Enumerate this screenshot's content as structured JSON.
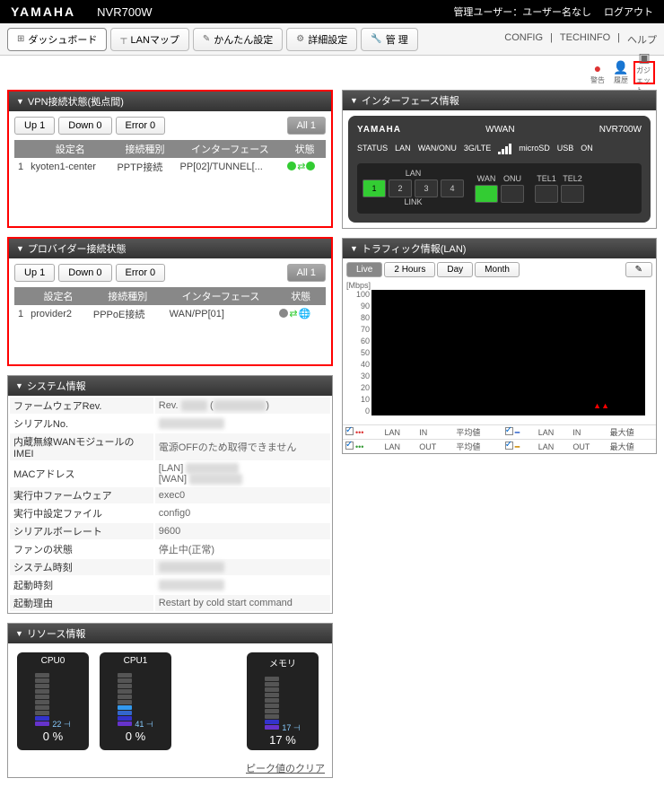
{
  "header": {
    "logo": "YAMAHA",
    "product": "NVR700W",
    "admin_user_label": "管理ユーザー：ユーザー名なし",
    "logout": "ログアウト"
  },
  "nav": {
    "tabs": {
      "dashboard": "ダッシュボード",
      "lanmap": "LANマップ",
      "easy": "かんたん設定",
      "detail": "詳細設定",
      "manage": "管 理"
    },
    "links": {
      "config": "CONFIG",
      "techinfo": "TECHINFO",
      "help": "ヘルプ"
    }
  },
  "toolbar": {
    "alert": "警告",
    "account": "履歴",
    "gadget": "ガジェット"
  },
  "vpn": {
    "title": "VPN接続状態(拠点間)",
    "up": "Up  1",
    "down": "Down  0",
    "error": "Error  0",
    "all": "All   1",
    "headers": {
      "name": "設定名",
      "type": "接続種別",
      "iface": "インターフェース",
      "status": "状態"
    },
    "rows": [
      {
        "idx": "1",
        "name": "kyoten1-center",
        "type": "PPTP接続",
        "iface": "PP[02]/TUNNEL[..."
      }
    ]
  },
  "provider": {
    "title": "プロバイダー接続状態",
    "up": "Up  1",
    "down": "Down  0",
    "error": "Error  0",
    "all": "All   1",
    "headers": {
      "name": "設定名",
      "type": "接続種別",
      "iface": "インターフェース",
      "status": "状態"
    },
    "rows": [
      {
        "idx": "1",
        "name": "provider2",
        "type": "PPPoE接続",
        "iface": "WAN/PP[01]"
      }
    ]
  },
  "system": {
    "title": "システム情報",
    "rows": [
      {
        "k": "ファームウェアRev.",
        "v": "Rev."
      },
      {
        "k": "シリアルNo.",
        "v": ""
      },
      {
        "k": "内蔵無線WANモジュールのIMEI",
        "v": "電源OFFのため取得できません"
      },
      {
        "k": "MACアドレス",
        "v": "[LAN]\n[WAN]"
      },
      {
        "k": "実行中ファームウェア",
        "v": "exec0"
      },
      {
        "k": "実行中設定ファイル",
        "v": "config0"
      },
      {
        "k": "シリアルボーレート",
        "v": "9600"
      },
      {
        "k": "ファンの状態",
        "v": "停止中(正常)"
      },
      {
        "k": "システム時刻",
        "v": ""
      },
      {
        "k": "起動時刻",
        "v": ""
      },
      {
        "k": "起動理由",
        "v": "Restart by cold start command"
      }
    ]
  },
  "resource": {
    "title": "リソース情報",
    "items": [
      {
        "label": "CPU0",
        "value": "0",
        "suffix": "%",
        "peak": "22"
      },
      {
        "label": "CPU1",
        "value": "0",
        "suffix": "%",
        "peak": "41"
      },
      {
        "label": "メモリ",
        "value": "17",
        "suffix": "%",
        "peak": "17"
      }
    ],
    "peak_clear": "ピーク値のクリア"
  },
  "iface": {
    "title": "インターフェース情報",
    "wwan": "WWAN",
    "product": "NVR700W",
    "labels": [
      "STATUS",
      "LAN",
      "WAN/ONU",
      "3G/LTE",
      "microSD",
      "USB",
      "ON"
    ],
    "groups": {
      "lan": "LAN",
      "wan": "WAN",
      "onu": "ONU",
      "tel1": "TEL1",
      "tel2": "TEL2",
      "link": "LINK"
    },
    "ports": {
      "lan": [
        "1",
        "2",
        "3",
        "4"
      ]
    }
  },
  "traffic": {
    "title": "トラフィック情報(LAN)",
    "buttons": {
      "live": "Live",
      "h2": "2 Hours",
      "day": "Day",
      "month": "Month"
    },
    "unit": "[Mbps]",
    "yticks": [
      "100",
      "90",
      "80",
      "70",
      "60",
      "50",
      "40",
      "30",
      "20",
      "10",
      "0"
    ],
    "legend": {
      "r1": [
        "LAN",
        "IN",
        "平均値",
        "LAN",
        "IN",
        "最大値"
      ],
      "r2": [
        "LAN",
        "OUT",
        "平均値",
        "LAN",
        "OUT",
        "最大値"
      ]
    }
  },
  "chart_data": {
    "type": "line",
    "title": "トラフィック情報(LAN)",
    "ylabel": "Mbps",
    "ylim": [
      0,
      100
    ],
    "series": [
      {
        "name": "LAN IN 平均値",
        "values": [
          0,
          0,
          0,
          0,
          0,
          0,
          0,
          0,
          0,
          0,
          0,
          0,
          0,
          0,
          0,
          0,
          0,
          0,
          0,
          0
        ]
      },
      {
        "name": "LAN OUT 平均値",
        "values": [
          0,
          0,
          0,
          0,
          0,
          0,
          0,
          0,
          0,
          0,
          0,
          0,
          0,
          0,
          0,
          0,
          0,
          0,
          0,
          0
        ]
      },
      {
        "name": "LAN IN 最大値",
        "values": [
          0,
          0,
          0,
          0,
          0,
          0,
          0,
          0,
          0,
          0,
          0,
          0,
          0,
          0,
          0,
          0,
          0,
          0,
          0,
          0
        ]
      },
      {
        "name": "LAN OUT 最大値",
        "values": [
          0,
          0,
          0,
          0,
          0,
          0,
          0,
          0,
          0,
          0,
          0,
          0,
          0,
          0,
          0,
          0,
          0,
          0,
          0,
          0
        ]
      }
    ]
  }
}
